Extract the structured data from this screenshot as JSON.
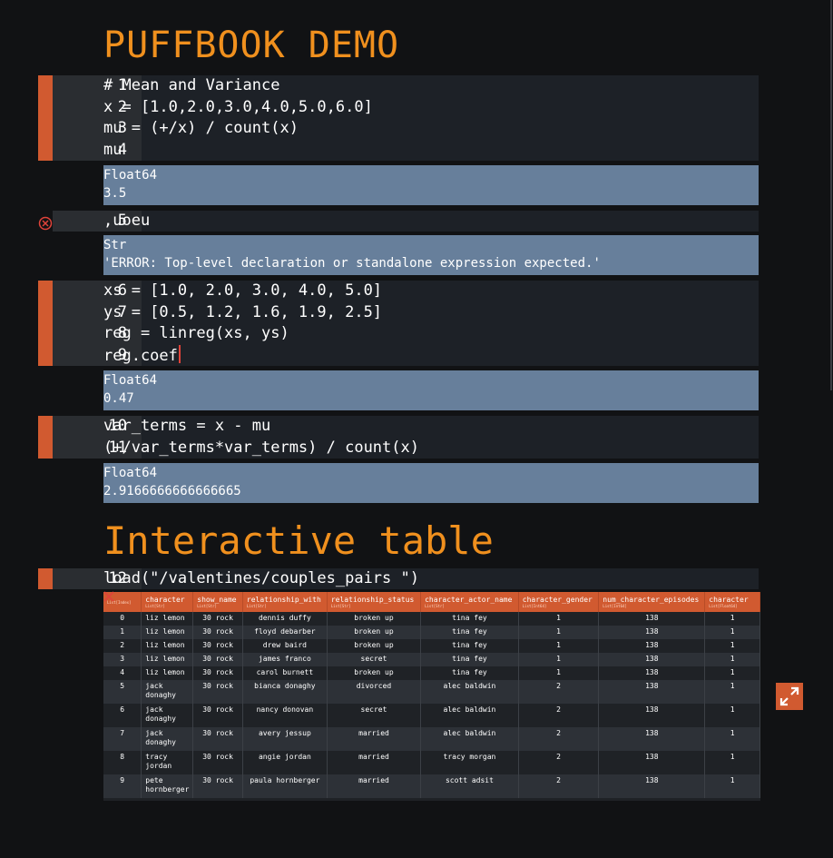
{
  "page": {
    "title": "PUFFBOOK DEMO",
    "section_title": "Interactive table"
  },
  "colors": {
    "accent": "#f0901e",
    "cell_bar": "#d15a30",
    "output_bg": "#677f9b",
    "error": "#e0433a"
  },
  "cells": [
    {
      "lines": [
        {
          "num": "1",
          "text": "# Mean and Variance"
        },
        {
          "num": "2",
          "text": "x = [1.0,2.0,3.0,4.0,5.0,6.0]"
        },
        {
          "num": "3",
          "text": "mu = (+/x) / count(x)"
        },
        {
          "num": "4",
          "text": "mu"
        }
      ],
      "output": {
        "type": "Float64",
        "value": "3.5"
      }
    },
    {
      "lines": [
        {
          "num": "5",
          "text": ",uoeu"
        }
      ],
      "error_icon": "error-circle-icon",
      "output": {
        "type": "Str",
        "value": "'ERROR: Top-level declaration or standalone expression expected.'"
      }
    },
    {
      "lines": [
        {
          "num": "6",
          "text": "xs = [1.0, 2.0, 3.0, 4.0, 5.0]"
        },
        {
          "num": "7",
          "text": "ys = [0.5, 1.2, 1.6, 1.9, 2.5]"
        },
        {
          "num": "8",
          "text": "reg = linreg(xs, ys)"
        },
        {
          "num": "9",
          "text": "reg.coef"
        }
      ],
      "output": {
        "type": "Float64",
        "value": "0.47"
      }
    },
    {
      "lines": [
        {
          "num": "10",
          "text": "var_terms = x - mu"
        },
        {
          "num": "11",
          "text": "(+/var_terms*var_terms) / count(x)"
        }
      ],
      "output": {
        "type": "Float64",
        "value": "2.9166666666666665"
      }
    },
    {
      "lines": [
        {
          "num": "12",
          "text": "load(\"/valentines/couples_pairs \")"
        }
      ]
    }
  ],
  "table": {
    "close_icon": "close-x-icon",
    "expand_icon": "expand-arrows-icon",
    "columns": [
      {
        "name": "",
        "type": "List[Index]"
      },
      {
        "name": "character",
        "type": "List[Str]"
      },
      {
        "name": "show_name",
        "type": "List[Str]"
      },
      {
        "name": "relationship_with",
        "type": "List[Str]"
      },
      {
        "name": "relationship_status",
        "type": "List[Str]"
      },
      {
        "name": "character_actor_name",
        "type": "List[Str]"
      },
      {
        "name": "character_gender",
        "type": "List[Int64]"
      },
      {
        "name": "num_character_episodes",
        "type": "List[Int64]"
      },
      {
        "name": "character",
        "type": "List[Float64]"
      }
    ],
    "rows": [
      [
        "0",
        "liz lemon",
        "30 rock",
        "dennis duffy",
        "broken up",
        "tina fey",
        "1",
        "138",
        "1"
      ],
      [
        "1",
        "liz lemon",
        "30 rock",
        "floyd debarber",
        "broken up",
        "tina fey",
        "1",
        "138",
        "1"
      ],
      [
        "2",
        "liz lemon",
        "30 rock",
        "drew baird",
        "broken up",
        "tina fey",
        "1",
        "138",
        "1"
      ],
      [
        "3",
        "liz lemon",
        "30 rock",
        "james franco",
        "secret",
        "tina fey",
        "1",
        "138",
        "1"
      ],
      [
        "4",
        "liz lemon",
        "30 rock",
        "carol burnett",
        "broken up",
        "tina fey",
        "1",
        "138",
        "1"
      ],
      [
        "5",
        "jack donaghy",
        "30 rock",
        "bianca donaghy",
        "divorced",
        "alec baldwin",
        "2",
        "138",
        "1"
      ],
      [
        "6",
        "jack donaghy",
        "30 rock",
        "nancy donovan",
        "secret",
        "alec baldwin",
        "2",
        "138",
        "1"
      ],
      [
        "7",
        "jack donaghy",
        "30 rock",
        "avery jessup",
        "married",
        "alec baldwin",
        "2",
        "138",
        "1"
      ],
      [
        "8",
        "tracy jordan",
        "30 rock",
        "angie jordan",
        "married",
        "tracy morgan",
        "2",
        "138",
        "1"
      ],
      [
        "9",
        "pete hornberger",
        "30 rock",
        "paula hornberger",
        "married",
        "scott adsit",
        "2",
        "138",
        "1"
      ]
    ]
  }
}
